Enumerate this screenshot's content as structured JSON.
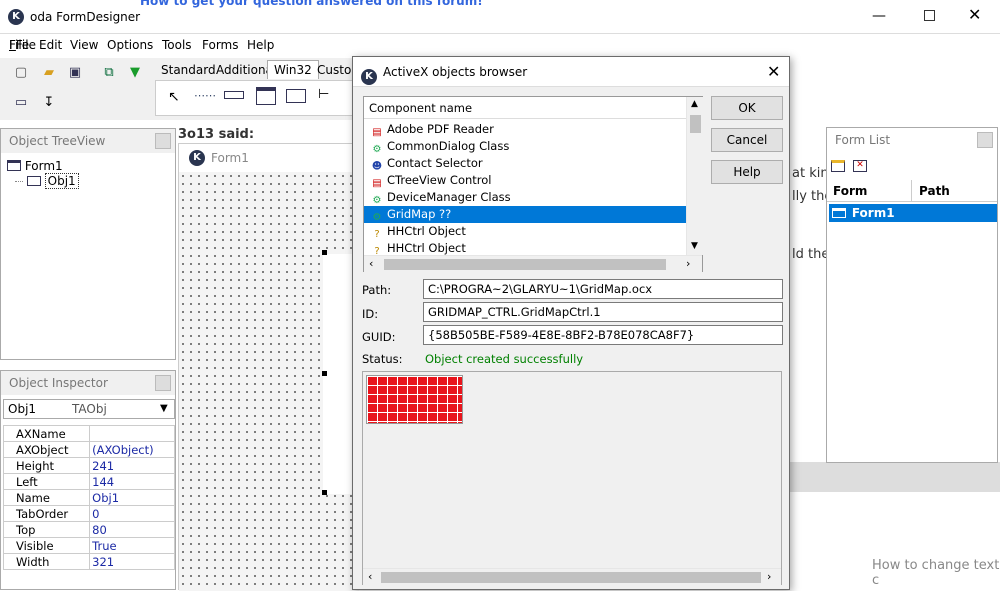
{
  "window": {
    "title": "oda FormDesigner",
    "bg_heading": "How to get your question answered on this forum!"
  },
  "menu": [
    "File",
    "Edit",
    "View",
    "Options",
    "Tools",
    "Forms",
    "Help"
  ],
  "palette_tabs": [
    "Standard",
    "Additional",
    "Win32",
    "Custom"
  ],
  "object_treeview": {
    "title": "Object TreeView",
    "root": "Form1",
    "child": "Obj1"
  },
  "object_inspector": {
    "title": "Object Inspector",
    "selected_name": "Obj1",
    "selected_class": "TAObj",
    "rows": [
      {
        "name": "AXName",
        "value": ""
      },
      {
        "name": "AXObject",
        "value": "(AXObject)"
      },
      {
        "name": "Height",
        "value": "241"
      },
      {
        "name": "Left",
        "value": "144"
      },
      {
        "name": "Name",
        "value": "Obj1"
      },
      {
        "name": "TabOrder",
        "value": "0"
      },
      {
        "name": "Top",
        "value": "80"
      },
      {
        "name": "Visible",
        "value": "True"
      },
      {
        "name": "Width",
        "value": "321"
      }
    ]
  },
  "background": {
    "quote_header": "3o13 said:",
    "frag1": "at kin",
    "frag2": "lly the",
    "frag3": "ld the",
    "bottom_link": "How to change text c"
  },
  "form1": {
    "title": "Form1"
  },
  "form_list": {
    "title": "Form List",
    "col_form": "Form",
    "col_path": "Path",
    "row_form": "Form1"
  },
  "dialog": {
    "title": "ActiveX objects browser",
    "list_header": "Component name",
    "items": [
      {
        "label": "Adobe PDF Reader",
        "icon": "pdf-icon"
      },
      {
        "label": "CommonDialog Class",
        "icon": "component-icon"
      },
      {
        "label": "Contact Selector",
        "icon": "contact-icon"
      },
      {
        "label": "CTreeView Control",
        "icon": "pdf-icon"
      },
      {
        "label": "DeviceManager Class",
        "icon": "component-icon"
      },
      {
        "label": "GridMap ??",
        "icon": "component-icon"
      },
      {
        "label": "HHCtrl Object",
        "icon": "help-icon"
      },
      {
        "label": "HHCtrl Object",
        "icon": "help-icon"
      }
    ],
    "selected_index": 5,
    "ok_label": "OK",
    "cancel_label": "Cancel",
    "help_label": "Help",
    "path_label": "Path:",
    "path_value": "C:\\PROGRA~2\\GLARYU~1\\GridMap.ocx",
    "id_label": "ID:",
    "id_value": "GRIDMAP_CTRL.GridMapCtrl.1",
    "guid_label": "GUID:",
    "guid_value": "{58B505BE-F589-4E8E-8BF2-B78E078CA8F7}",
    "status_label": "Status:",
    "status_value": "Object created successfully",
    "status_color": "#008000",
    "grid_color": "#e8141c"
  }
}
